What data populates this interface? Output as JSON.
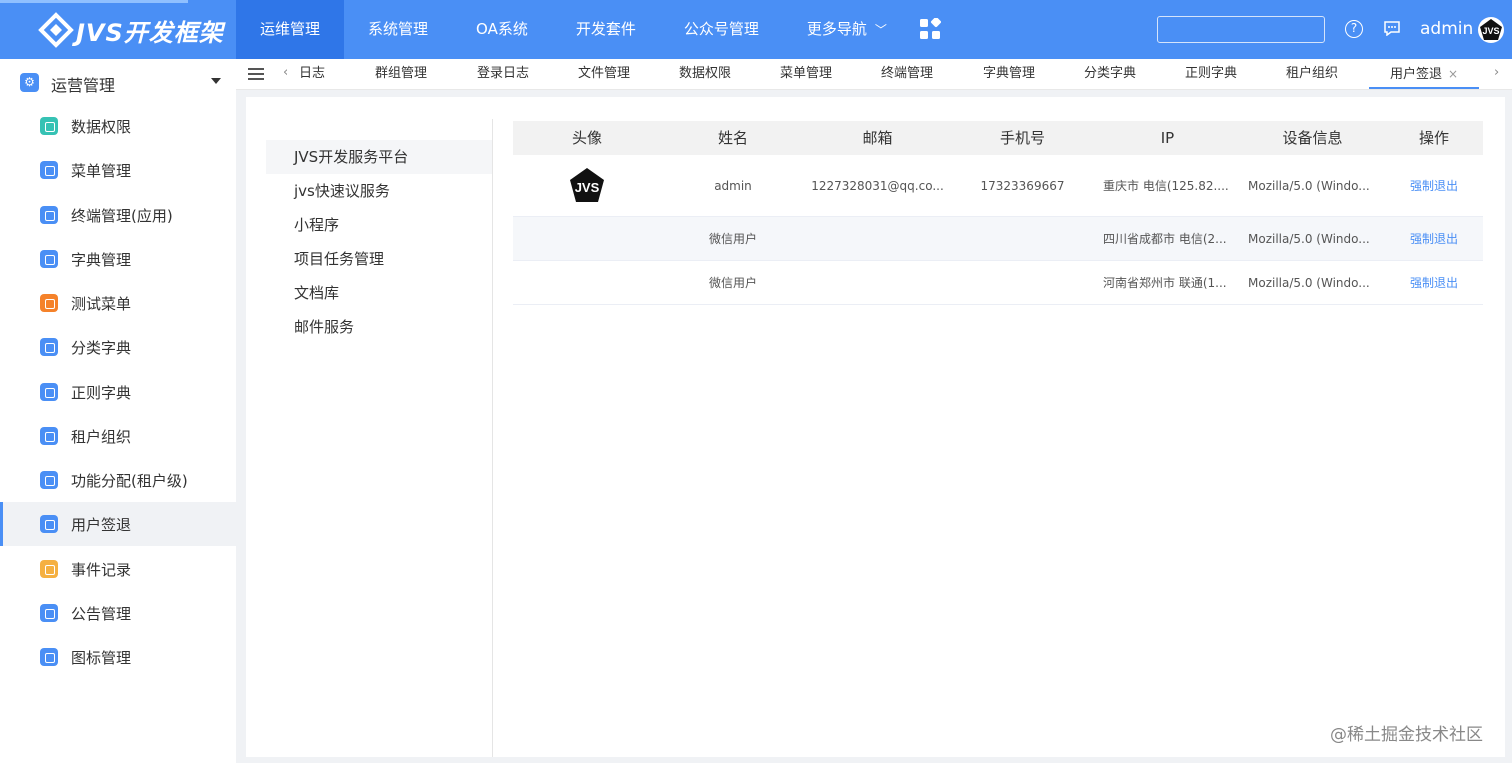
{
  "header": {
    "logo_text": "JVS开发框架",
    "nav": [
      {
        "label": "运维管理",
        "active": true
      },
      {
        "label": "系统管理",
        "active": false
      },
      {
        "label": "OA系统",
        "active": false
      },
      {
        "label": "开发套件",
        "active": false
      },
      {
        "label": "公众号管理",
        "active": false
      },
      {
        "label": "更多导航",
        "active": false
      }
    ],
    "search_placeholder": "",
    "username": "admin",
    "colors": {
      "primary": "#4a8ff5",
      "active_nav": "#2f76e8"
    }
  },
  "sidebar": {
    "group_title": "运营管理",
    "items": [
      {
        "label": "数据权限",
        "icon": "shield-data-icon",
        "color": "#36c2b4",
        "active": false
      },
      {
        "label": "菜单管理",
        "icon": "menu-icon",
        "color": "#4a8ff5",
        "active": false
      },
      {
        "label": "终端管理(应用)",
        "icon": "terminal-icon",
        "color": "#4a8ff5",
        "active": false
      },
      {
        "label": "字典管理",
        "icon": "dictionary-icon",
        "color": "#4a8ff5",
        "active": false
      },
      {
        "label": "测试菜单",
        "icon": "home-icon",
        "color": "#f5822a",
        "active": false
      },
      {
        "label": "分类字典",
        "icon": "chart-icon",
        "color": "#4a8ff5",
        "active": false
      },
      {
        "label": "正则字典",
        "icon": "regex-icon",
        "color": "#4a8ff5",
        "active": false
      },
      {
        "label": "租户组织",
        "icon": "organization-icon",
        "color": "#4a8ff5",
        "active": false
      },
      {
        "label": "功能分配(租户级)",
        "icon": "box-icon",
        "color": "#4a8ff5",
        "active": false
      },
      {
        "label": "用户签退",
        "icon": "logout-icon",
        "color": "#4a8ff5",
        "active": true
      },
      {
        "label": "事件记录",
        "icon": "record-icon",
        "color": "#f5b041",
        "active": false
      },
      {
        "label": "公告管理",
        "icon": "notice-icon",
        "color": "#4a8ff5",
        "active": false
      },
      {
        "label": "图标管理",
        "icon": "icon-manage-icon",
        "color": "#4a8ff5",
        "active": false
      }
    ]
  },
  "tabs": [
    {
      "label": "日志",
      "active": false
    },
    {
      "label": "群组管理",
      "active": false
    },
    {
      "label": "登录日志",
      "active": false
    },
    {
      "label": "文件管理",
      "active": false
    },
    {
      "label": "数据权限",
      "active": false
    },
    {
      "label": "菜单管理",
      "active": false
    },
    {
      "label": "终端管理",
      "active": false
    },
    {
      "label": "字典管理",
      "active": false
    },
    {
      "label": "分类字典",
      "active": false
    },
    {
      "label": "正则字典",
      "active": false
    },
    {
      "label": "租户组织",
      "active": false
    },
    {
      "label": "用户签退",
      "active": true
    }
  ],
  "tab_close_glyph": "×",
  "services": [
    {
      "label": "JVS开发服务平台",
      "active": true
    },
    {
      "label": "jvs快速议服务",
      "active": false
    },
    {
      "label": "小程序",
      "active": false
    },
    {
      "label": "项目任务管理",
      "active": false
    },
    {
      "label": "文档库",
      "active": false
    },
    {
      "label": "邮件服务",
      "active": false
    }
  ],
  "table": {
    "columns": [
      "头像",
      "姓名",
      "邮箱",
      "手机号",
      "IP",
      "设备信息",
      "操作"
    ],
    "rows": [
      {
        "has_avatar": true,
        "name": "admin",
        "email": "1227328031@qq.co...",
        "phone": "17323369667",
        "ip": "重庆市 电信(125.82....",
        "device": "Mozilla/5.0 (Windo...",
        "action": "强制退出"
      },
      {
        "has_avatar": false,
        "name": "微信用户",
        "email": "",
        "phone": "",
        "ip": "四川省成都市 电信(2...",
        "device": "Mozilla/5.0 (Windo...",
        "action": "强制退出"
      },
      {
        "has_avatar": false,
        "name": "微信用户",
        "email": "",
        "phone": "",
        "ip": "河南省郑州市 联通(1...",
        "device": "Mozilla/5.0 (Windo...",
        "action": "强制退出"
      }
    ]
  },
  "watermark": "@稀土掘金技术社区"
}
